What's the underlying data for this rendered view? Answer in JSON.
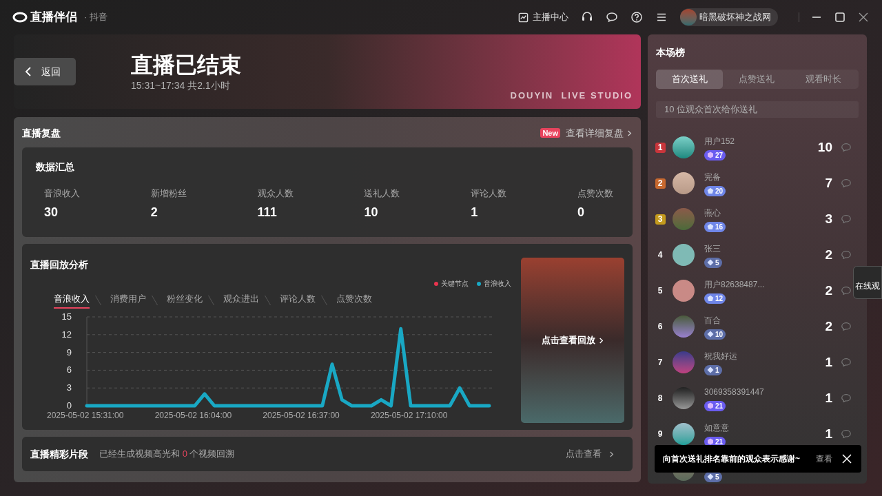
{
  "app": {
    "name": "直播伴侣",
    "platform": "· 抖音"
  },
  "toolbar": {
    "center_button": "主播中心",
    "user_name": "暗黑破坏神之战网"
  },
  "banner": {
    "back_button": "返回",
    "title": "直播已结束",
    "subtitle": "15:31~17:34 共2.1小时",
    "brand_text": "DOUYIN  LIVE STUDIO"
  },
  "review": {
    "title": "直播复盘",
    "new_badge": "New",
    "detail_link": "查看详细复盘",
    "summary": {
      "title": "数据汇总",
      "stats": [
        {
          "label": "音浪收入",
          "value": "30"
        },
        {
          "label": "新增粉丝",
          "value": "2"
        },
        {
          "label": "观众人数",
          "value": "111"
        },
        {
          "label": "送礼人数",
          "value": "10"
        },
        {
          "label": "评论人数",
          "value": "1"
        },
        {
          "label": "点赞次数",
          "value": "0"
        }
      ]
    },
    "analysis": {
      "title": "直播回放分析",
      "legend": [
        {
          "label": "关键节点",
          "color": "#e8344e"
        }
      ],
      "tabs": [
        {
          "label": "音浪收入",
          "selected": true
        },
        {
          "label": "消费用户",
          "selected": false
        },
        {
          "label": "粉丝变化",
          "selected": false
        },
        {
          "label": "观众进出",
          "selected": false
        },
        {
          "label": "评论人数",
          "selected": false
        },
        {
          "label": "点赞次数",
          "selected": false
        }
      ],
      "chart_data": {
        "type": "line",
        "categories": [
          "2025-05-02 15:31:00",
          null,
          null,
          null,
          null,
          null,
          null,
          null,
          null,
          null,
          null,
          "2025-05-02 16:04:00",
          null,
          null,
          null,
          null,
          null,
          null,
          null,
          null,
          null,
          null,
          "2025-05-02 16:37:00",
          null,
          null,
          null,
          null,
          null,
          null,
          null,
          null,
          null,
          null,
          "2025-05-02 17:10:00",
          null,
          null,
          null,
          null,
          null,
          null,
          null,
          null
        ],
        "series": [
          {
            "name": "音浪收入",
            "color": "#19a8c4",
            "values": [
              0,
              0,
              0,
              0,
              0,
              0,
              0,
              0,
              0,
              0,
              0,
              0,
              2,
              0,
              0,
              0,
              0,
              0,
              0,
              0,
              0,
              0,
              0,
              0,
              0,
              7,
              1,
              0,
              0,
              0,
              1,
              0,
              13,
              0,
              0,
              0,
              0,
              0,
              3,
              0,
              0,
              0
            ]
          }
        ],
        "ylim": [
          0,
          15
        ],
        "grid": true,
        "yticks": [
          0,
          3,
          6,
          9,
          12,
          15
        ]
      },
      "replay_button": "点击查看回放"
    },
    "highlights": {
      "title": "直播精彩片段",
      "text_before": "已经生成视频高光和",
      "count": "0",
      "text_after": "个视频回溯",
      "link": "点击查看"
    }
  },
  "ranking": {
    "title": "本场榜",
    "tabs": [
      {
        "label": "首次送礼",
        "selected": true
      },
      {
        "label": "点赞送礼",
        "selected": false
      },
      {
        "label": "观看时长",
        "selected": false
      }
    ],
    "summary": "10 位观众首次给你送礼",
    "rows": [
      {
        "kind": "hexagon",
        "rank": "1",
        "color": "#c9353b",
        "name": "用户152",
        "badge": "27",
        "score": "10"
      },
      {
        "kind": "pentagon",
        "rank": "2",
        "color": "#c8692f",
        "name": "完备",
        "badge": "20",
        "score": "7"
      },
      {
        "kind": "pentagon",
        "rank": "3",
        "color": "#c49a1d",
        "name": "燕心",
        "badge": "16",
        "score": "3"
      },
      {
        "kind": "diamond",
        "rank": "4",
        "name": "张三",
        "badge": "5",
        "score": "2"
      },
      {
        "kind": "pentagon",
        "rank": "5",
        "name": "用户82638487...",
        "badge": "12",
        "score": "2"
      },
      {
        "kind": "diamond",
        "rank": "6",
        "name": "百合",
        "badge": "10",
        "score": "2"
      },
      {
        "kind": "diamond",
        "rank": "7",
        "name": "祝我好运",
        "badge": "1",
        "score": "1"
      },
      {
        "kind": "hexagon",
        "rank": "8",
        "name": "3069358391447",
        "badge": "21",
        "score": "1"
      },
      {
        "kind": "hexagon",
        "rank": "9",
        "name": "如意意",
        "badge": "21",
        "score": "1"
      },
      {
        "kind": "diamond",
        "badge": "5"
      }
    ],
    "toast": {
      "text": "向首次送礼排名靠前的观众表示感谢~",
      "link": "查看"
    }
  },
  "side_panel": {
    "text": "在线观"
  }
}
